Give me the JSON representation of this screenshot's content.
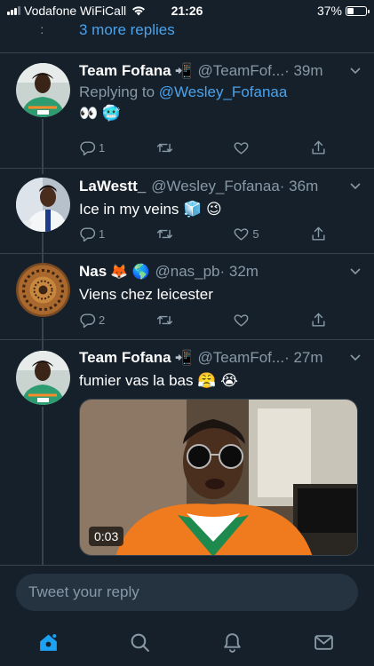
{
  "status_bar": {
    "carrier": "Vodafone WiFiCall",
    "time": "21:26",
    "battery": "37%",
    "battery_level": 0.37
  },
  "thread": {
    "more_replies": "3 more replies"
  },
  "tweets": [
    {
      "name": "Team Fofana",
      "name_emoji": "📲",
      "handle": "@TeamFof...",
      "time": "· 39m",
      "replying_prefix": "Replying to",
      "replying_to": "@Wesley_Fofanaa",
      "text": "👀 🥶",
      "actions": {
        "replies": "1",
        "retweets": "",
        "likes": ""
      }
    },
    {
      "name": "LaWestt_",
      "handle": "@Wesley_Fofanaa",
      "time": "· 36m",
      "text": "Ice in my veins 🧊 😉",
      "actions": {
        "replies": "1",
        "retweets": "",
        "likes": "5"
      }
    },
    {
      "name": "Nas",
      "name_emoji": "🦊 🌎",
      "handle": "@nas_pb",
      "time": "· 32m",
      "text": "Viens chez leicester",
      "actions": {
        "replies": "2",
        "retweets": "",
        "likes": ""
      }
    },
    {
      "name": "Team Fofana",
      "name_emoji": "📲",
      "handle": "@TeamFof...",
      "time": "· 27m",
      "text": "fumier vas la bas 😤 😭",
      "media": {
        "duration": "0:03"
      }
    }
  ],
  "reply_box": {
    "placeholder": "Tweet your reply"
  },
  "icons": {
    "reply": "reply-icon",
    "retweet": "retweet-icon",
    "like": "heart-icon",
    "share": "share-icon",
    "home": "home-icon",
    "search": "search-icon",
    "notifications": "bell-icon",
    "messages": "mail-icon"
  },
  "colors": {
    "background": "#15202b",
    "accent": "#1da1f2",
    "link": "#4aa3ed",
    "secondary_text": "#8899a6",
    "divider": "#38444d"
  }
}
